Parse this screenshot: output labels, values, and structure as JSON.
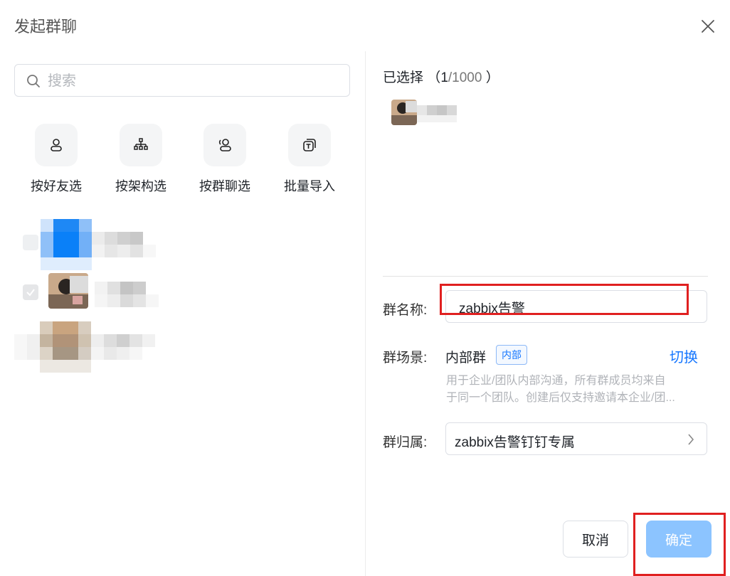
{
  "dialog": {
    "title": "发起群聊",
    "close_icon": "close-icon"
  },
  "search": {
    "placeholder": "搜索"
  },
  "select_modes": [
    {
      "label": "按好友选",
      "icon": "friend-icon"
    },
    {
      "label": "按架构选",
      "icon": "org-structure-icon"
    },
    {
      "label": "按群聊选",
      "icon": "group-chat-icon"
    },
    {
      "label": "批量导入",
      "icon": "batch-import-icon"
    }
  ],
  "selected": {
    "label": "已选择",
    "count": "1",
    "max": "/1000",
    "open_paren": "（",
    "close_paren": "）"
  },
  "group_name": {
    "label": "群名称:",
    "value": "zabbix告警"
  },
  "group_scene": {
    "label": "群场景:",
    "value": "内部群",
    "tag": "内部",
    "switch_label": "切换",
    "desc_line1": "用于企业/团队内部沟通，所有群成员均来自",
    "desc_line2": "于同一个团队。创建后仅支持邀请本企业/团..."
  },
  "group_owner": {
    "label": "群归属:",
    "value": "zabbix告警钉钉专属"
  },
  "buttons": {
    "cancel": "取消",
    "confirm": "确定"
  },
  "colors": {
    "primary": "#1677ff",
    "confirm_disabled": "#8cc4ff",
    "highlight_box": "#e02020"
  }
}
